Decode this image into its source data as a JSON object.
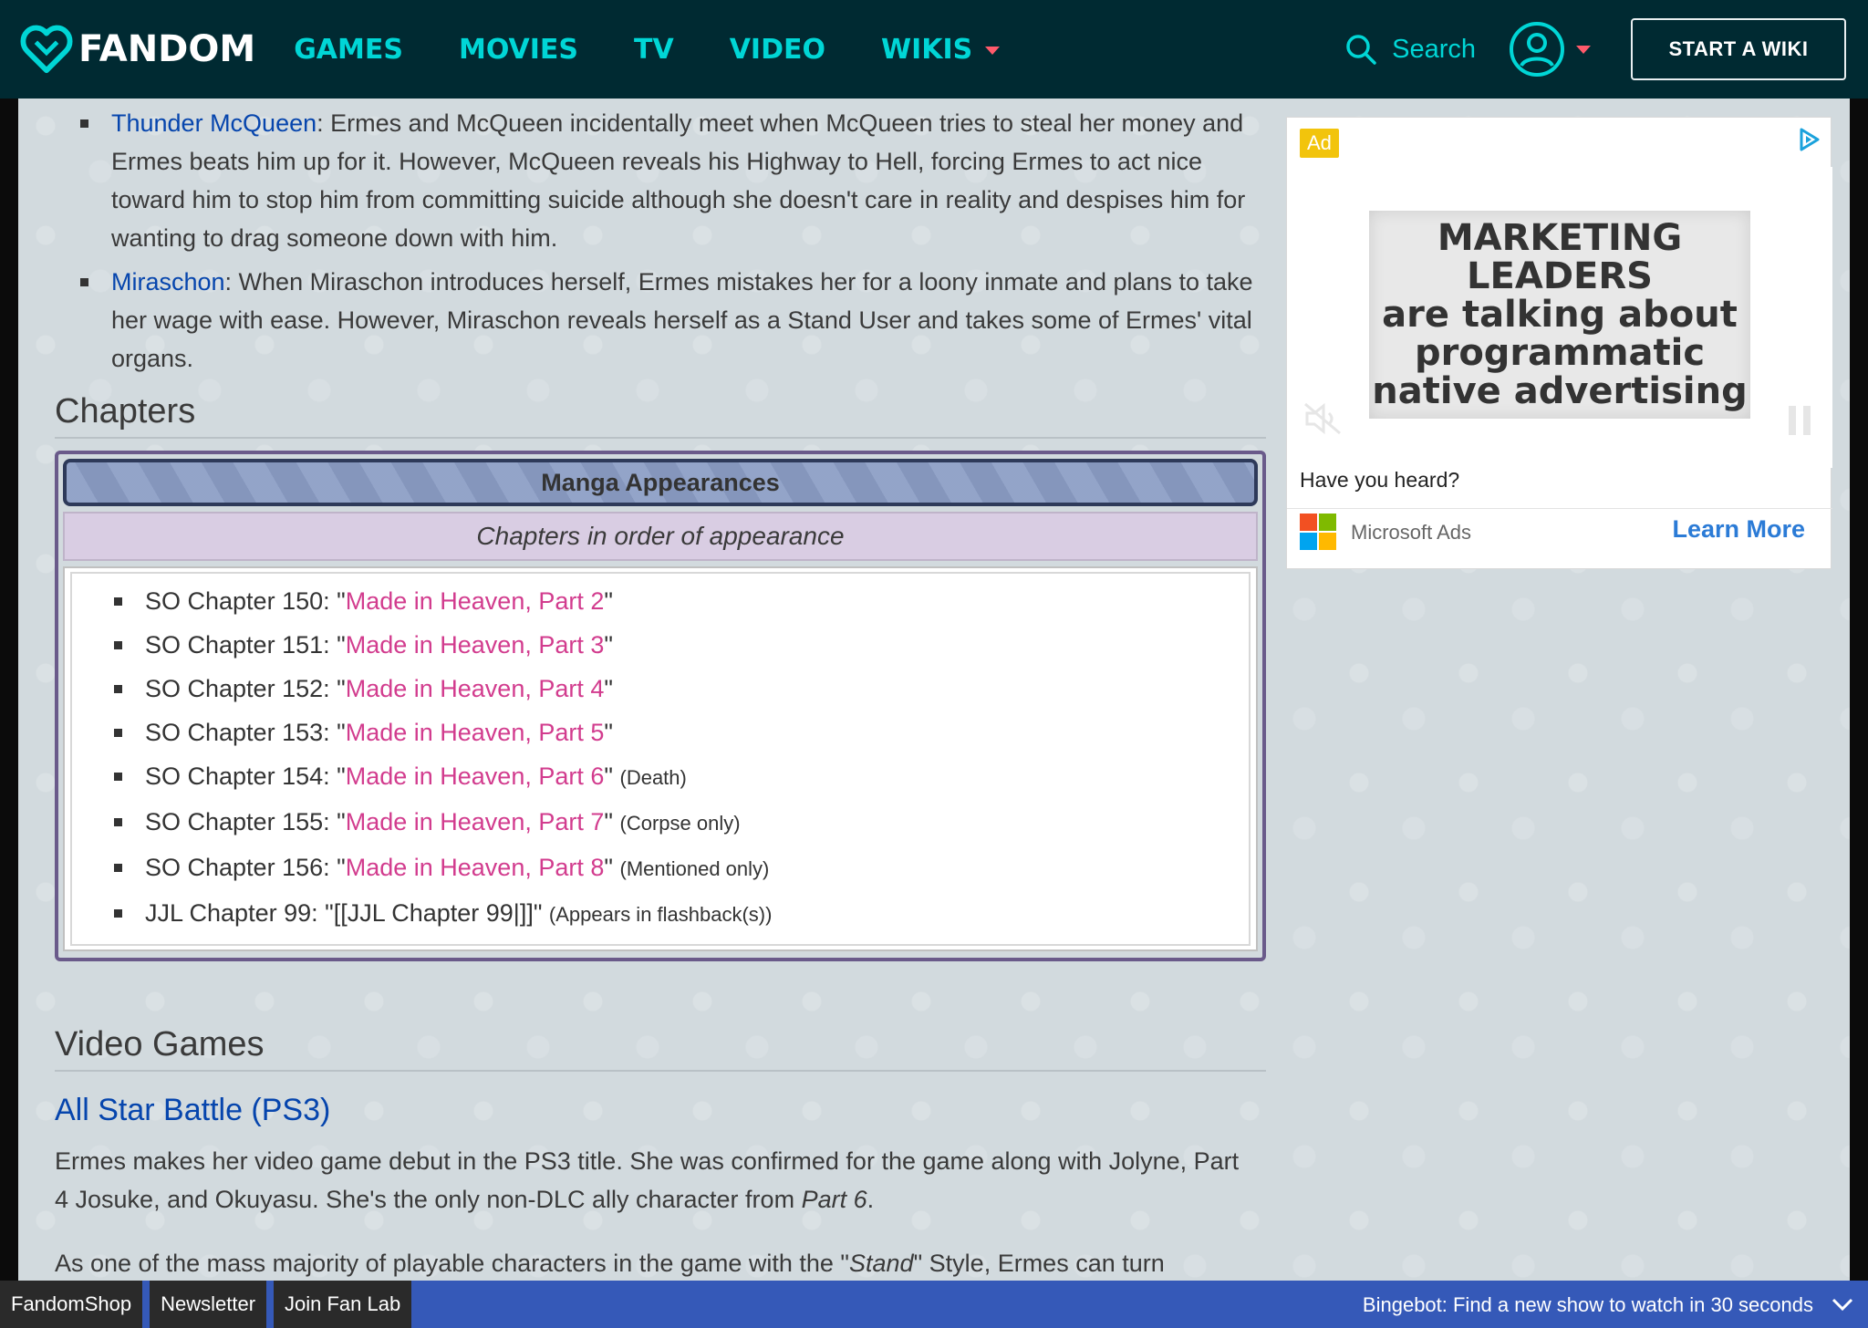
{
  "nav": {
    "brand": "FANDOM",
    "links": [
      "GAMES",
      "MOVIES",
      "TV",
      "VIDEO",
      "WIKIS"
    ],
    "search_label": "Search",
    "start_wiki": "START A WIKI"
  },
  "relationships": [
    {
      "name": "Thunder McQueen",
      "text": ": Ermes and McQueen incidentally meet when McQueen tries to steal her money and Ermes beats him up for it. However, McQueen reveals his Highway to Hell, forcing Ermes to act nice toward him to stop him from committing suicide although she doesn't care in reality and despises him for wanting to drag someone down with him."
    },
    {
      "name": "Miraschon",
      "text": ": When Miraschon introduces herself, Ermes mistakes her for a loony inmate and plans to take her wage with ease. However, Miraschon reveals herself as a Stand User and takes some of Ermes' vital organs."
    }
  ],
  "chapters": {
    "heading": "Chapters",
    "box_title": "Manga Appearances",
    "box_subtitle": "Chapters in order of appearance",
    "items": [
      {
        "prefix": "SO Chapter 150: \"",
        "link": "Made in Heaven, Part 2",
        "suffix": "\"",
        "note": ""
      },
      {
        "prefix": "SO Chapter 151: \"",
        "link": "Made in Heaven, Part 3",
        "suffix": "\"",
        "note": ""
      },
      {
        "prefix": "SO Chapter 152: \"",
        "link": "Made in Heaven, Part 4",
        "suffix": "\"",
        "note": ""
      },
      {
        "prefix": "SO Chapter 153: \"",
        "link": "Made in Heaven, Part 5",
        "suffix": "\"",
        "note": ""
      },
      {
        "prefix": "SO Chapter 154: \"",
        "link": "Made in Heaven, Part 6",
        "suffix": "\"",
        "note": "(Death)"
      },
      {
        "prefix": "SO Chapter 155: \"",
        "link": "Made in Heaven, Part 7",
        "suffix": "\"",
        "note": "(Corpse only)"
      },
      {
        "prefix": "SO Chapter 156: \"",
        "link": "Made in Heaven, Part 8",
        "suffix": "\"",
        "note": "(Mentioned only)"
      },
      {
        "prefix": "JJL Chapter 99: \"[[JJL Chapter 99|]]\"",
        "link": "",
        "suffix": "",
        "note": "(Appears in flashback(s))"
      }
    ]
  },
  "video_games": {
    "heading": "Video Games",
    "subheading": "All Star Battle (PS3)",
    "para1_pre": "Ermes makes her video game debut in the PS3 title. She was confirmed for the game along with Jolyne, Part 4 Josuke, and Okuyasu. She's the only non-DLC ally character from ",
    "para1_em": "Part 6",
    "para1_post": ".",
    "para2_pre": "As one of the mass majority of playable characters in the game with the \"",
    "para2_em": "Stand",
    "para2_post": "\" Style, Ermes can turn"
  },
  "ad": {
    "badge": "Ad",
    "headline_lines": [
      "MARKETING LEADERS",
      "are talking about",
      "programmatic",
      "native advertising"
    ],
    "caption": "Have you heard?",
    "sponsor": "Microsoft Ads",
    "cta": "Learn More"
  },
  "bottombar": {
    "buttons": [
      "FandomShop",
      "Newsletter",
      "Join Fan Lab"
    ],
    "promo": "Bingebot: Find a new show to watch in 30 seconds"
  },
  "colors": {
    "nav_bg": "#002a32",
    "nav_link": "#00d6d6",
    "caret": "#ff5a6b",
    "link_blue": "#0645ad",
    "link_pink": "#d23c8e",
    "bottombar": "#3559b8"
  }
}
